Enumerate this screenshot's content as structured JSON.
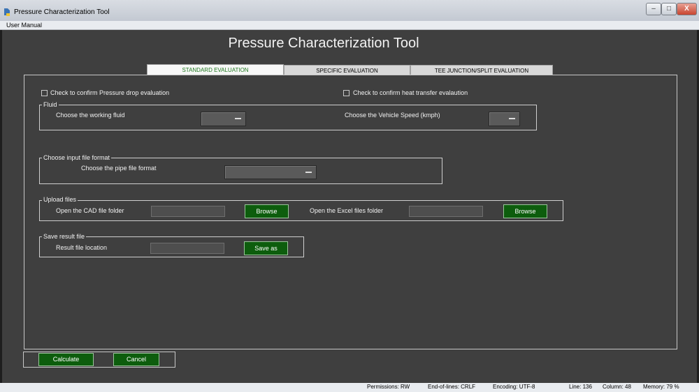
{
  "window": {
    "title": "Pressure Characterization Tool",
    "minimize": "–",
    "maximize": "□",
    "close": "X"
  },
  "menu": {
    "user_manual": "User Manual"
  },
  "app_title": "Pressure Characterization Tool",
  "tabs": [
    {
      "label": "STANDARD EVALUATION",
      "active": true
    },
    {
      "label": "SPECIFIC EVALUATION",
      "active": false
    },
    {
      "label": "TEE JUNCTION/SPLIT EVALUATION",
      "active": false
    }
  ],
  "checks": {
    "pressure_drop": "Check to confirm Pressure drop evaluation",
    "heat_transfer": "Check to confirm heat transfer evalaution"
  },
  "fluid": {
    "title": "Fluid",
    "working_fluid_label": "Choose the working fluid",
    "working_fluid_value": "",
    "vehicle_speed_label": "Choose the Vehicle Speed (kmph)",
    "vehicle_speed_value": ""
  },
  "input_format": {
    "title": "Choose input file format",
    "pipe_label": "Choose the pipe file format",
    "pipe_value": ""
  },
  "upload": {
    "title": "Upload files",
    "cad_label": "Open the CAD file folder",
    "cad_value": "",
    "browse_label": "Browse",
    "excel_label": "Open the Excel files folder",
    "excel_value": ""
  },
  "save": {
    "title": "Save result file",
    "location_label": "Result file location",
    "location_value": "",
    "save_as_label": "Save as"
  },
  "actions": {
    "calculate": "Calculate",
    "cancel": "Cancel"
  },
  "status": {
    "permissions": "Permissions:  RW",
    "eol": "End-of-lines:  CRLF",
    "encoding": "Encoding:  UTF-8",
    "line": "Line:  136",
    "column": "Column:  48",
    "memory": "Memory:  79 %"
  },
  "colors": {
    "background": "#3f3f3f",
    "button": "#0d5d0d",
    "active_tab_text": "#1f7a1f"
  }
}
